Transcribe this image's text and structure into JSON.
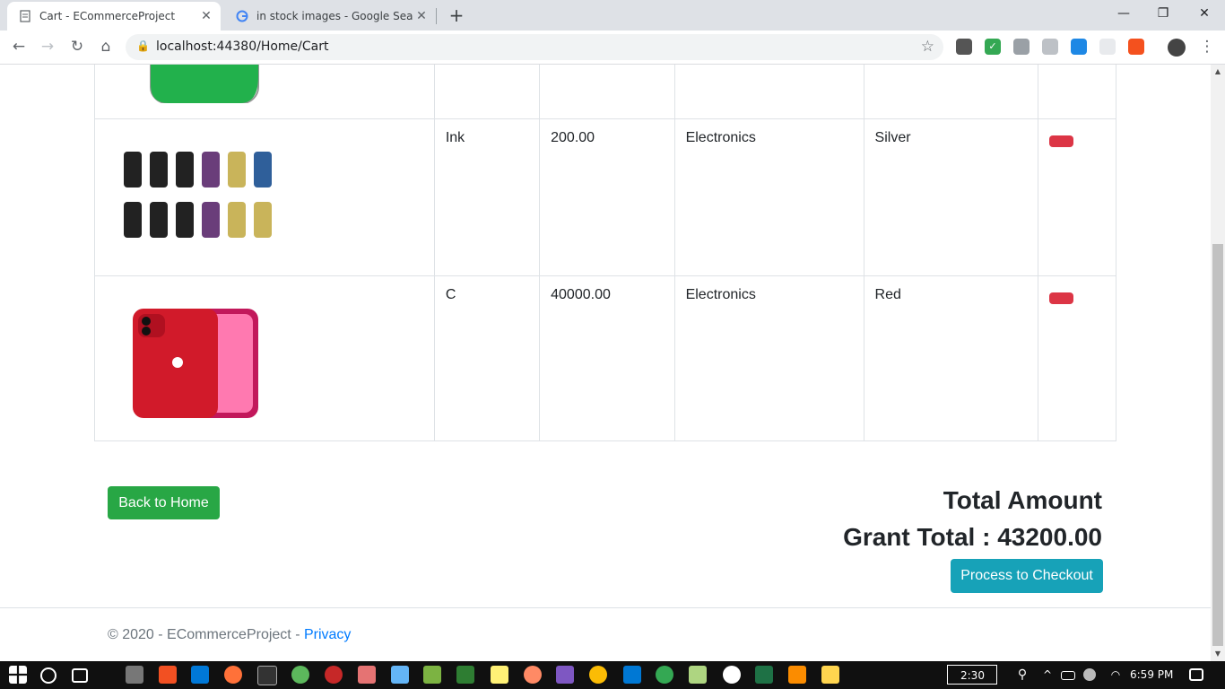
{
  "browser": {
    "tabs": [
      {
        "title": "Cart - ECommerceProject",
        "active": true
      },
      {
        "title": "in stock images - Google Search",
        "active": false
      }
    ],
    "url": "localhost:44380/Home/Cart"
  },
  "cart": {
    "rows": [
      {
        "name": "",
        "price": "",
        "category": "",
        "color": "",
        "image": "backpack"
      },
      {
        "name": "Ink",
        "price": "200.00",
        "category": "Electronics",
        "color": "Silver",
        "image": "vape-tanks"
      },
      {
        "name": "C",
        "price": "40000.00",
        "category": "Electronics",
        "color": "Red",
        "image": "red-phone"
      }
    ]
  },
  "actions": {
    "back_home": "Back to Home",
    "checkout": "Process to Checkout"
  },
  "totals": {
    "heading": "Total Amount",
    "grant_total": "Grant Total : 43200.00"
  },
  "footer": {
    "text": "© 2020 - ECommerceProject - ",
    "privacy": "Privacy"
  },
  "taskbar": {
    "clock": "6:59 PM",
    "box_text": "2:30"
  },
  "colors": {
    "success": "#28a745",
    "info": "#17a2b8",
    "danger": "#dc3545",
    "link": "#007bff"
  }
}
